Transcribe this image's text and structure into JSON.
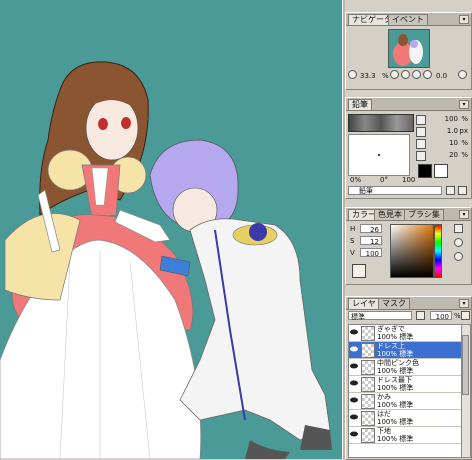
{
  "navigator": {
    "tabs": [
      "ナビゲータ",
      "イベント"
    ],
    "zoom": "33.3",
    "rotation": "0.0"
  },
  "pencil": {
    "tab": "鉛筆",
    "params": [
      {
        "value": "100",
        "unit": "%"
      },
      {
        "value": "1.0",
        "unit": "px"
      },
      {
        "value": "10",
        "unit": "%"
      },
      {
        "value": "20",
        "unit": "%"
      }
    ],
    "pct_a": "0%",
    "pct_b": "0°",
    "pct_c": "100",
    "tool_name": "鉛筆",
    "colors": {
      "main": "#000000",
      "sub": "#ffffff"
    }
  },
  "color": {
    "tabs": [
      "カラー",
      "色見本",
      "ブラシ集"
    ],
    "h": "26",
    "s": "12",
    "v": "100"
  },
  "layers": {
    "tabs": [
      "レイヤ",
      "マスク"
    ],
    "mode": "標準",
    "opacity": "100",
    "opacity_unit": "%",
    "items": [
      {
        "name": "ぎゃぎで",
        "detail": "100% 標準",
        "selected": false
      },
      {
        "name": "ドレス上",
        "detail": "100% 標準",
        "selected": true
      },
      {
        "name": "中間ピンク色",
        "detail": "100% 標準",
        "selected": false
      },
      {
        "name": "ドレス最下",
        "detail": "100% 標準",
        "selected": false
      },
      {
        "name": "かみ",
        "detail": "100% 標準",
        "selected": false
      },
      {
        "name": "はだ",
        "detail": "100% 標準",
        "selected": false
      },
      {
        "name": "下地",
        "detail": "100% 標準",
        "selected": false
      }
    ]
  },
  "colors": {
    "canvas_bg": "#4a9a98",
    "selection": "#3c6fd0"
  }
}
